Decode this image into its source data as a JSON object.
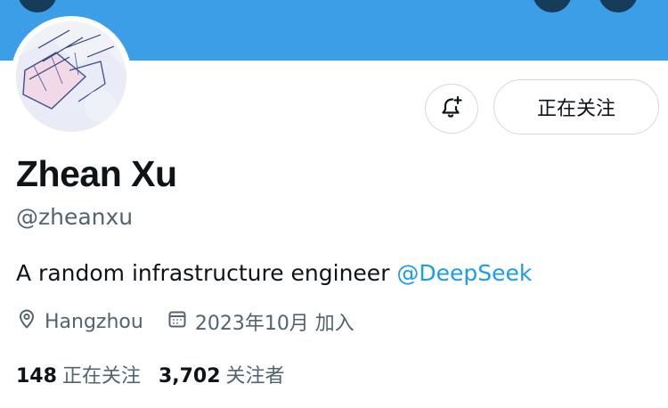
{
  "profile": {
    "name": "Zhean Xu",
    "handle": "@zheanxu",
    "bio_text": "A random infrastructure engineer ",
    "bio_mention": "@DeepSeek",
    "location": "Hangzhou",
    "joined": "2023年10月 加入"
  },
  "actions": {
    "follow_label": "正在关注"
  },
  "stats": {
    "following_count": "148",
    "following_label": "正在关注",
    "followers_count": "3,702",
    "followers_label": "关注者"
  },
  "colors": {
    "banner": "#3d9ee8",
    "link": "#1d9bf0",
    "muted": "#536471"
  },
  "icons": {
    "notify": "bell-plus-icon",
    "location": "location-pin-icon",
    "calendar": "calendar-icon"
  }
}
